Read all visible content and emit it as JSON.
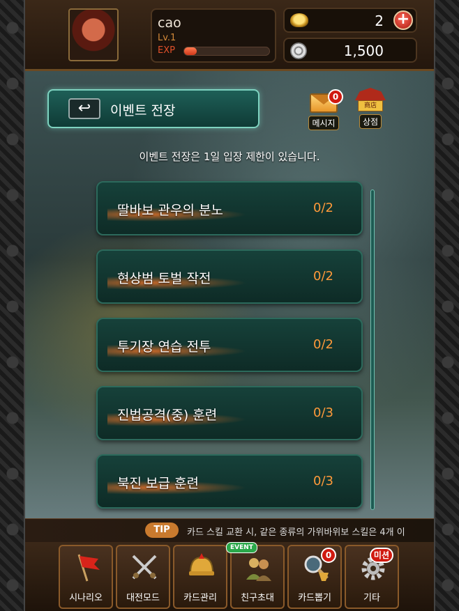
{
  "player": {
    "name": "cao",
    "level": "Lv.1",
    "exp_label": "EXP",
    "exp_progress": 0.15
  },
  "currency": {
    "gold": "2",
    "silver": "1,500",
    "add_label": "+"
  },
  "header": {
    "back_label": "이벤트 전장",
    "mail_label": "메시지",
    "mail_badge": "0",
    "shop_label": "상점",
    "shop_sign": "商店"
  },
  "notice": "이벤트 전장은 1일 입장 제한이 있습니다.",
  "events": [
    {
      "name": "딸바보 관우의 분노",
      "count": "0/2"
    },
    {
      "name": "현상범 토벌 작전",
      "count": "0/2"
    },
    {
      "name": "투기장 연습 전투",
      "count": "0/2"
    },
    {
      "name": "진법공격(중) 훈련",
      "count": "0/3"
    },
    {
      "name": "북진 보급 훈련",
      "count": "0/3"
    }
  ],
  "tip": {
    "label": "TIP",
    "text": "카드 스킬 교환 시, 같은 종류의 가위바위보 스킬은 4개 이"
  },
  "nav": [
    {
      "label": "시나리오",
      "icon": "flag-icon"
    },
    {
      "label": "대전모드",
      "icon": "crossed-swords-icon"
    },
    {
      "label": "카드관리",
      "icon": "helmet-icon"
    },
    {
      "label": "친구초대",
      "icon": "friends-icon",
      "tag": "EVENT"
    },
    {
      "label": "카드뽑기",
      "icon": "magnifier-icon",
      "badge": "0"
    },
    {
      "label": "기타",
      "icon": "gear-icon",
      "badge": "미션"
    }
  ]
}
